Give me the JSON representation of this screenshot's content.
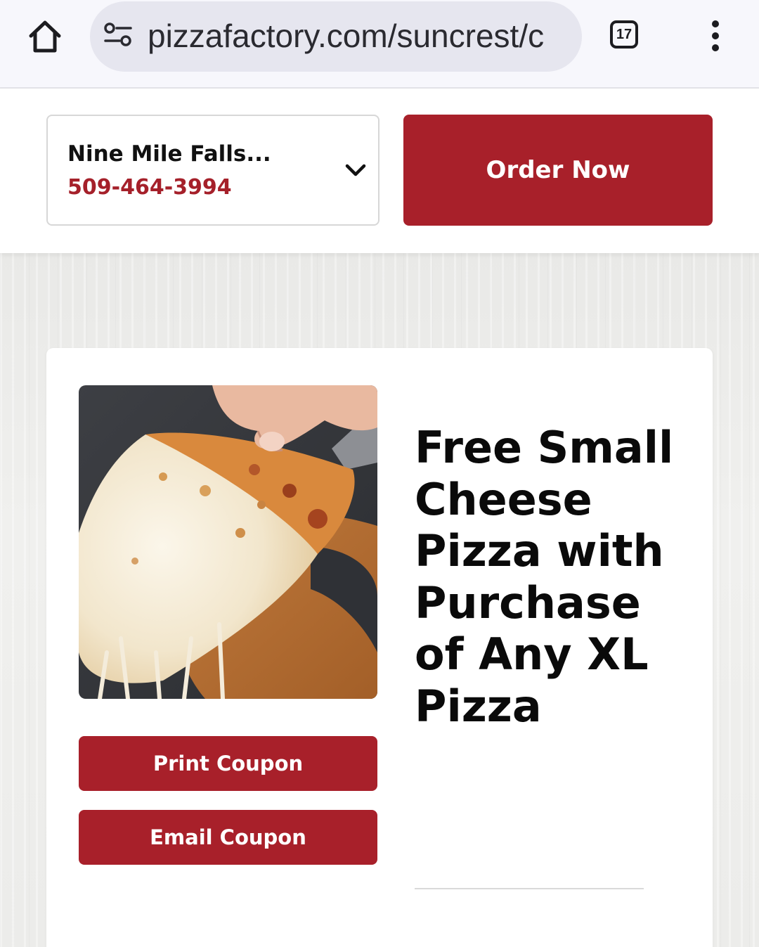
{
  "browser": {
    "url": "pizzafactory.com/suncrest/c",
    "tab_count": "17",
    "icons": [
      "home-icon",
      "site-info-icon",
      "tab-switcher-icon",
      "more-vert-icon"
    ]
  },
  "header": {
    "location_name": "Nine Mile Falls...",
    "location_phone": "509-464-3994",
    "order_button": "Order Now",
    "colors": {
      "brand_red": "#a8202a",
      "phone_red": "#a5202a"
    }
  },
  "coupon": {
    "title": "Free Small Cheese Pizza with Purchase of Any XL Pizza",
    "print_button": "Print Coupon",
    "email_button": "Email Coupon"
  }
}
